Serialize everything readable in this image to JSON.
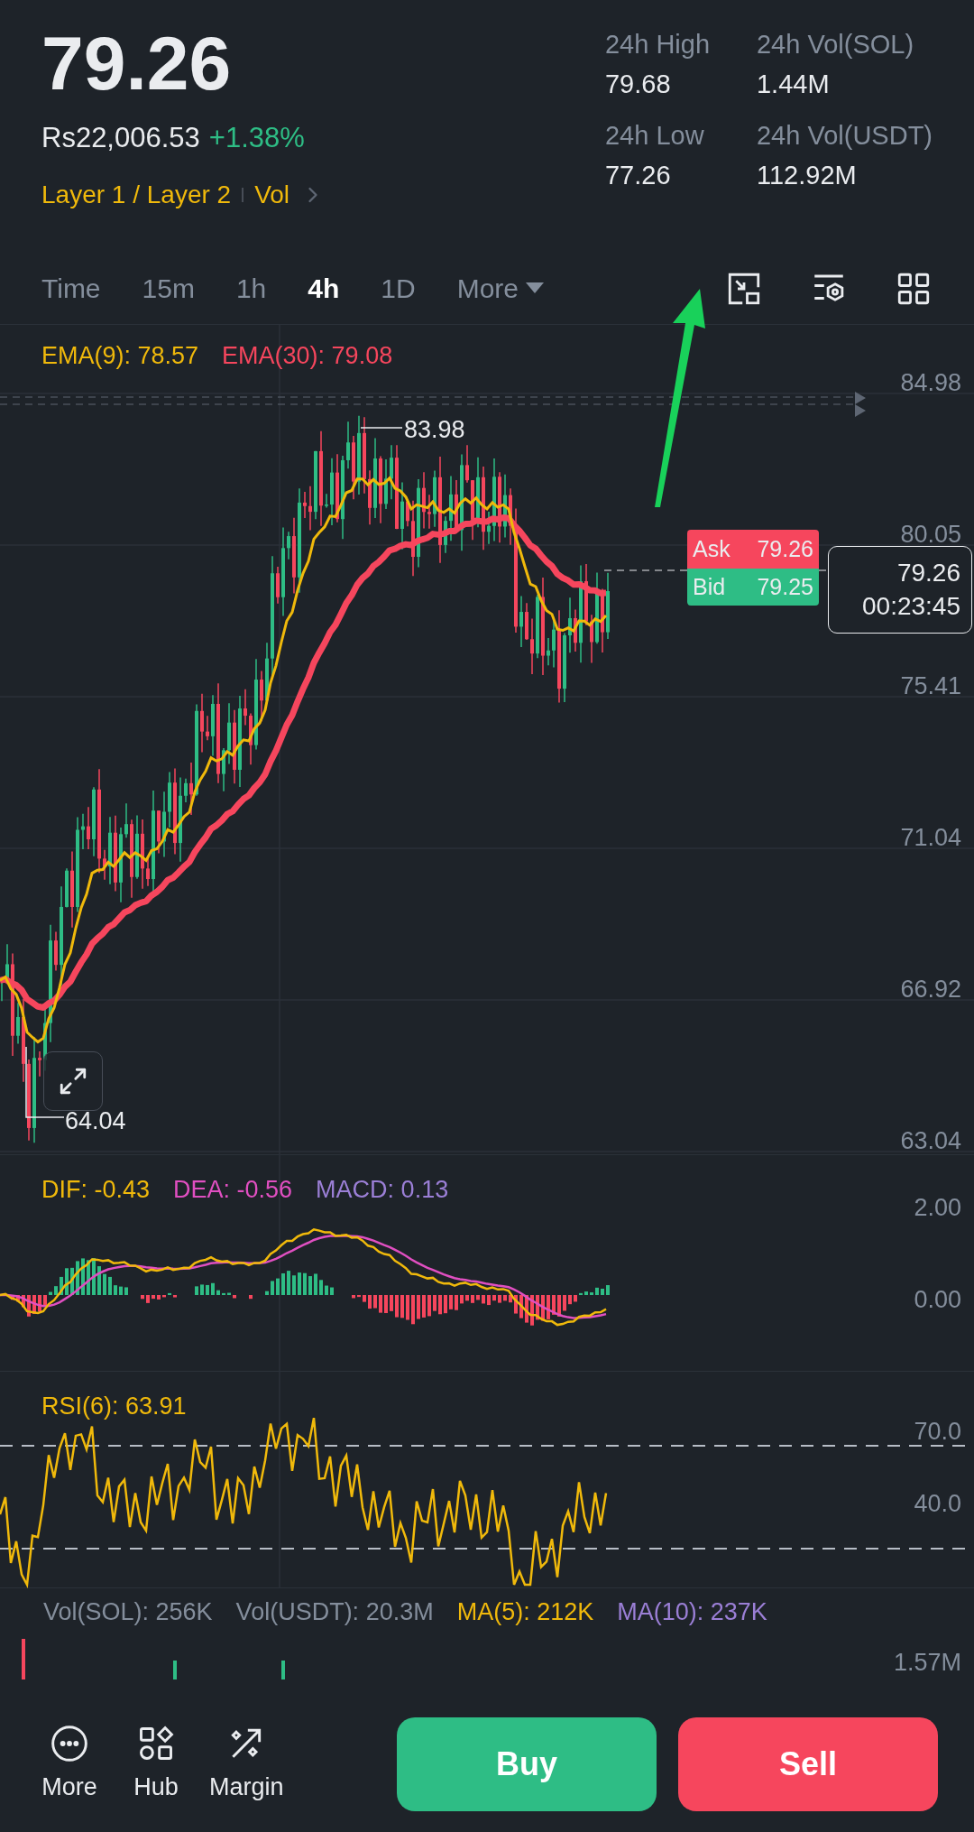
{
  "header": {
    "price": "79.26",
    "fiat_price": "Rs22,006.53",
    "change": "+1.38%",
    "tags": [
      "Layer 1 / Layer 2",
      "Vol"
    ],
    "stats": [
      {
        "label": "24h High",
        "value": "79.68"
      },
      {
        "label": "24h Vol(SOL)",
        "value": "1.44M"
      },
      {
        "label": "24h Low",
        "value": "77.26"
      },
      {
        "label": "24h Vol(USDT)",
        "value": "112.92M"
      }
    ]
  },
  "intervals": [
    {
      "label": "Time",
      "selected": false,
      "kind": "plain"
    },
    {
      "label": "15m",
      "selected": false,
      "kind": "plain"
    },
    {
      "label": "1h",
      "selected": false,
      "kind": "plain"
    },
    {
      "label": "4h",
      "selected": true,
      "kind": "plain"
    },
    {
      "label": "1D",
      "selected": false,
      "kind": "plain"
    },
    {
      "label": "More",
      "selected": false,
      "kind": "dropdown"
    }
  ],
  "main_chart": {
    "legend": [
      {
        "text": "EMA(9): 78.57",
        "color": "#f0b90b"
      },
      {
        "text": "EMA(30): 79.08",
        "color": "#f6465d"
      }
    ],
    "y_labels": [
      "84.98",
      "80.05",
      "75.41",
      "71.04",
      "66.92",
      "63.04"
    ],
    "high_label": "83.98",
    "low_label": "64.04",
    "ask": {
      "label": "Ask",
      "value": "79.26"
    },
    "bid": {
      "label": "Bid",
      "value": "79.25"
    },
    "last_price": "79.26",
    "countdown": "00:23:45"
  },
  "macd": {
    "legend": [
      {
        "text": "DIF: -0.43",
        "color": "#f0b90b"
      },
      {
        "text": "DEA: -0.56",
        "color": "#e04fc1"
      },
      {
        "text": "MACD: 0.13",
        "color": "#9b7fd6"
      }
    ],
    "y_labels": [
      "2.00",
      "0.00"
    ]
  },
  "rsi": {
    "legend": [
      {
        "text": "RSI(6): 63.91",
        "color": "#f0b90b"
      }
    ],
    "y_labels": [
      "70.0",
      "40.0"
    ]
  },
  "volume": {
    "legend": [
      {
        "text": "Vol(SOL): 256K",
        "color": "#848e9c"
      },
      {
        "text": "Vol(USDT): 20.3M",
        "color": "#848e9c"
      },
      {
        "text": "MA(5): 212K",
        "color": "#f0b90b"
      },
      {
        "text": "MA(10): 237K",
        "color": "#9b7fd6"
      }
    ],
    "y_labels": [
      "1.57M"
    ]
  },
  "bottom_bar": {
    "actions": [
      {
        "label": "More",
        "kind": "more"
      },
      {
        "label": "Hub",
        "kind": "hub"
      },
      {
        "label": "Margin",
        "kind": "margin"
      }
    ],
    "buy": "Buy",
    "sell": "Sell"
  }
}
